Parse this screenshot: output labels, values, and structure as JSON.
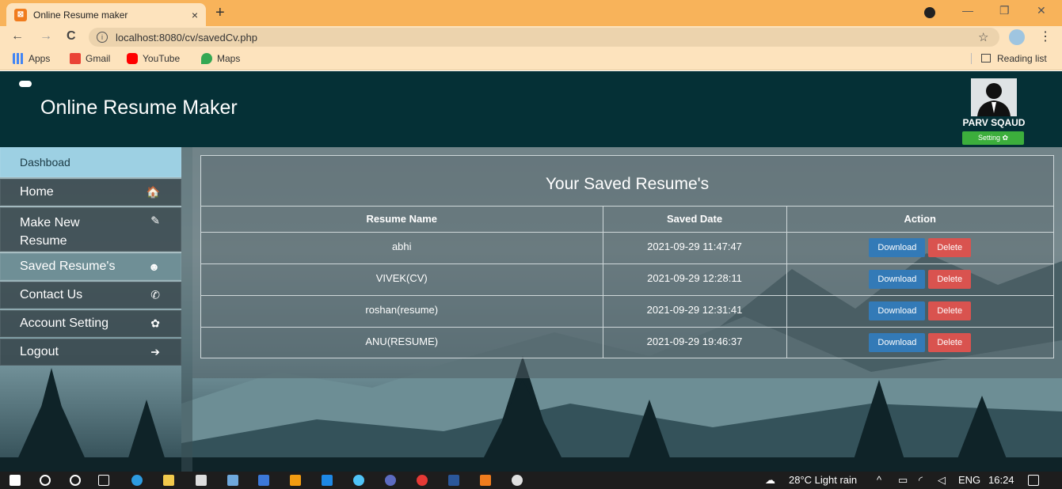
{
  "browser": {
    "tab_title": "Online Resume maker",
    "tab_close": "×",
    "new_tab": "+",
    "url": "localhost:8080/cv/savedCv.php",
    "bookmarks": [
      "Apps",
      "Gmail",
      "YouTube",
      "Maps"
    ],
    "reading_list": "Reading list",
    "icons": {
      "back": "←",
      "forward": "→",
      "reload": "C",
      "info": "i",
      "star": "☆",
      "menu": "⋮",
      "minimize": "—",
      "restore": "❐",
      "close": "✕"
    }
  },
  "header": {
    "title": "Online Resume Maker",
    "username": "PARV SQAUD",
    "setting_label": "Setting ✿"
  },
  "sidebar": {
    "items": [
      {
        "label": "Dashboad",
        "icon": ""
      },
      {
        "label": "Home",
        "icon": "🏠"
      },
      {
        "label": "Make New Resume",
        "icon": "✎"
      },
      {
        "label": "Saved Resume's",
        "icon": "☻"
      },
      {
        "label": "Contact Us",
        "icon": "✆"
      },
      {
        "label": "Account Setting",
        "icon": "✿"
      },
      {
        "label": "Logout",
        "icon": "➔"
      }
    ]
  },
  "content": {
    "title": "Your Saved Resume's",
    "columns": [
      "Resume Name",
      "Saved Date",
      "Action"
    ],
    "rows": [
      {
        "name": "abhi",
        "date": "2021-09-29 11:47:47"
      },
      {
        "name": "VIVEK(CV)",
        "date": "2021-09-29 12:28:11"
      },
      {
        "name": "roshan(resume)",
        "date": "2021-09-29 12:31:41"
      },
      {
        "name": "ANU(RESUME)",
        "date": "2021-09-29 19:46:37"
      }
    ],
    "download_label": "Download",
    "delete_label": "Delete"
  },
  "taskbar": {
    "weather": "28°C  Light rain",
    "language": "ENG",
    "time": "16:24"
  },
  "colors": {
    "header_bg": "#053036",
    "dashboard_bg": "#9dd0e3",
    "download_btn": "#337ab7",
    "delete_btn": "#d9534f",
    "setting_btn": "#3cae3c",
    "tab_bar": "#f8b35a"
  }
}
